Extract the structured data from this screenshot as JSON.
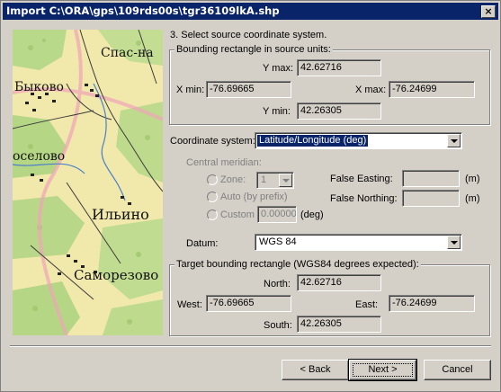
{
  "window": {
    "title": "Import C:\\ORA\\gps\\109rds00s\\tgr36109lkA.shp",
    "close_glyph": "×"
  },
  "map": {
    "labels": [
      "Спас-на",
      "Быково",
      "оселово",
      "Ильино",
      "Саморезово"
    ]
  },
  "step_title": "3. Select source coordinate system.",
  "source_group": {
    "title": "Bounding rectangle in source units:",
    "ymax_label": "Y max:",
    "ymax": "42.62716",
    "xmin_label": "X min:",
    "xmin": "-76.69665",
    "xmax_label": "X max:",
    "xmax": "-76.24699",
    "ymin_label": "Y min:",
    "ymin": "42.26305"
  },
  "coord_system": {
    "label": "Coordinate system:",
    "value": "Latitude/Longitude (deg)"
  },
  "meridian": {
    "label": "Central meridian:",
    "zone_label": "Zone:",
    "zone_value": "1",
    "auto_label": "Auto (by prefix)",
    "custom_label": "Custom",
    "custom_value": "0.00000",
    "custom_unit": "(deg)",
    "false_easting_label": "False Easting:",
    "false_easting_unit": "(m)",
    "false_northing_label": "False Northing:",
    "false_northing_unit": "(m)"
  },
  "datum": {
    "label": "Datum:",
    "value": "WGS 84"
  },
  "target_group": {
    "title": "Target bounding rectangle (WGS84 degrees expected):",
    "north_label": "North:",
    "north": "42.62716",
    "west_label": "West:",
    "west": "-76.69665",
    "east_label": "East:",
    "east": "-76.24699",
    "south_label": "South:",
    "south": "42.26305"
  },
  "buttons": {
    "back": "< Back",
    "next": "Next >",
    "cancel": "Cancel"
  }
}
